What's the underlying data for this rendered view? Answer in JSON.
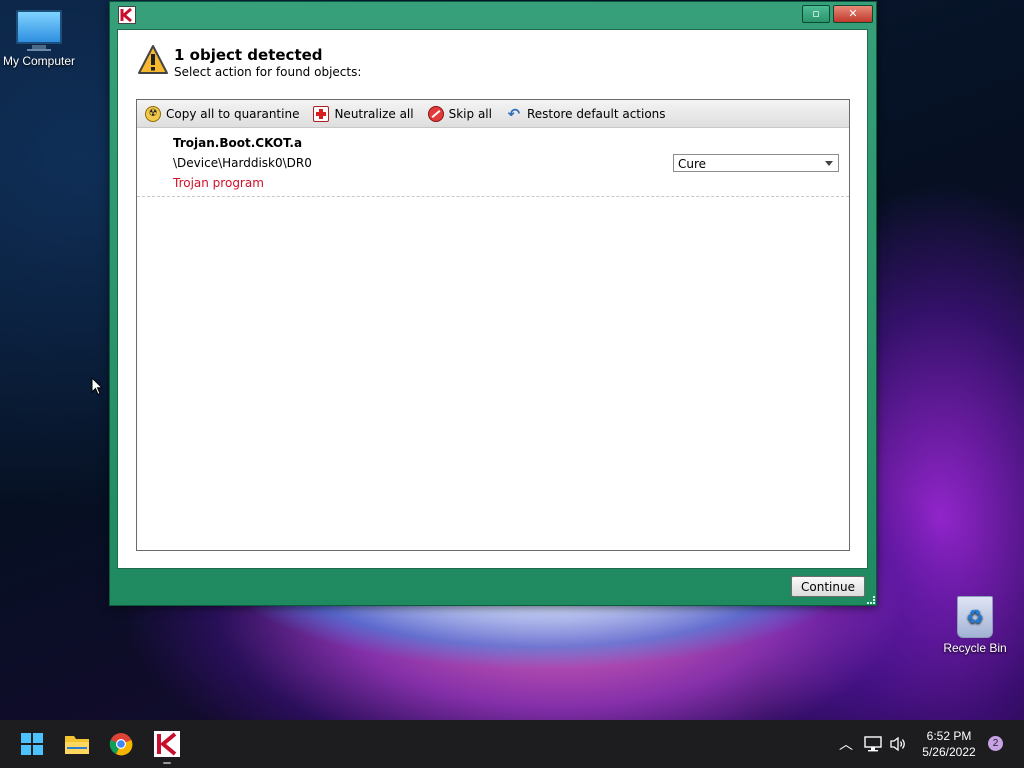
{
  "desktop": {
    "icons": [
      {
        "label": "My Computer"
      },
      {
        "label": "Recycle Bin"
      }
    ]
  },
  "dialog": {
    "heading": "1 object detected",
    "subheading": "Select action for found objects:",
    "toolbar": {
      "copy_quarantine": "Copy all to quarantine",
      "neutralize_all": "Neutralize all",
      "skip_all": "Skip all",
      "restore_defaults": "Restore default actions"
    },
    "threats": [
      {
        "name": "Trojan.Boot.CKOT.a",
        "path": "\\Device\\Harddisk0\\DR0",
        "type": "Trojan program",
        "action": "Cure"
      }
    ],
    "continue_label": "Continue",
    "colors": {
      "frame": "#2a946c",
      "threat_type": "#d0112a"
    }
  },
  "taskbar": {
    "apps": [
      "start-icon",
      "file-explorer-icon",
      "chrome-icon",
      "kaspersky-icon"
    ],
    "clock": {
      "time": "6:52 PM",
      "date": "5/26/2022"
    },
    "notification_count": "2"
  }
}
